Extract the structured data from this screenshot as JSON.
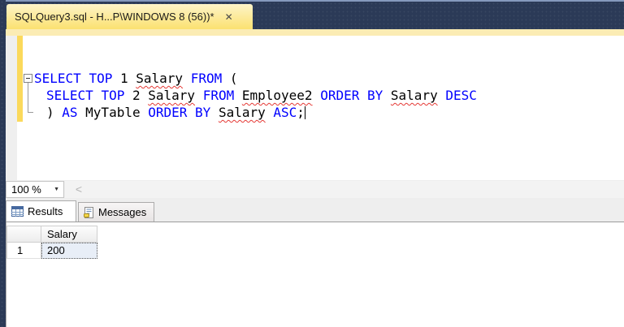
{
  "document_tab": {
    "title": "SQLQuery3.sql - H...P\\WINDOWS 8 (56))*",
    "close_glyph": "✕"
  },
  "editor": {
    "code": {
      "line1": [
        {
          "t": "SELECT"
        },
        {
          "t": " "
        },
        {
          "t": "TOP"
        },
        {
          "t": " 1 "
        },
        {
          "t": "Salary"
        },
        {
          "t": " "
        },
        {
          "t": "FROM"
        },
        {
          "t": " ("
        }
      ],
      "line2": [
        {
          "t": "SELECT"
        },
        {
          "t": " "
        },
        {
          "t": "TOP"
        },
        {
          "t": " 2 "
        },
        {
          "t": "Salary"
        },
        {
          "t": " "
        },
        {
          "t": "FROM"
        },
        {
          "t": " "
        },
        {
          "t": "Employee2"
        },
        {
          "t": " "
        },
        {
          "t": "ORDER BY"
        },
        {
          "t": " "
        },
        {
          "t": "Salary"
        },
        {
          "t": " "
        },
        {
          "t": "DESC"
        }
      ],
      "line3": [
        {
          "t": ") "
        },
        {
          "t": "AS"
        },
        {
          "t": " MyTable "
        },
        {
          "t": "ORDER BY"
        },
        {
          "t": " "
        },
        {
          "t": "Salary"
        },
        {
          "t": " "
        },
        {
          "t": "ASC"
        },
        {
          "t": ";"
        }
      ]
    }
  },
  "zoom_control": {
    "value": "100 %",
    "arrow": "▼",
    "scroll_left": "<"
  },
  "results_pane": {
    "tabs": {
      "results": "Results",
      "messages": "Messages"
    },
    "grid": {
      "columns": [
        "Salary"
      ],
      "rows": [
        {
          "n": "1",
          "cells": [
            "200"
          ]
        }
      ]
    }
  },
  "colors": {
    "keyword_blue": "#0000ff",
    "squiggle_red": "#e53935",
    "tab_yellow": "#fbe170",
    "band_yellow": "#fbecb4",
    "track_yellow": "#fbd95b",
    "navy": "#2b3a57",
    "selected_cell_bg": "#e8eef7"
  }
}
